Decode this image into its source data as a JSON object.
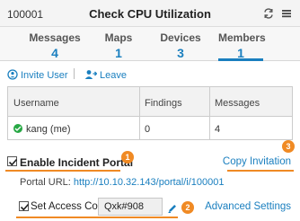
{
  "header": {
    "incident_id": "100001",
    "title": "Check CPU Utilization",
    "icons": [
      "refresh-icon",
      "menu-icon"
    ]
  },
  "tabs": [
    {
      "label": "Messages",
      "count": "4"
    },
    {
      "label": "Maps",
      "count": "1"
    },
    {
      "label": "Devices",
      "count": "3"
    },
    {
      "label": "Members",
      "count": "1",
      "active": true
    }
  ],
  "actions": {
    "invite_user": "Invite User",
    "leave": "Leave"
  },
  "members_table": {
    "columns": [
      "Username",
      "Findings",
      "Messages"
    ],
    "rows": [
      {
        "username": "kang (me)",
        "findings": "0",
        "messages": "4",
        "status": "online"
      }
    ]
  },
  "portal": {
    "enable_label": "Enable Incident Portal",
    "enabled": true,
    "copy_invitation": "Copy Invitation",
    "url_label": "Portal URL:",
    "url": "http://10.10.32.143/portal/i/100001",
    "set_access_code_label": "Set Access Code",
    "access_code_checked": true,
    "access_code_value": "Qxk#908",
    "advanced_settings": "Advanced Settings"
  },
  "callouts": [
    "1",
    "2",
    "3"
  ],
  "colors": {
    "accent": "#1a7fbf",
    "callout": "#f08a24",
    "online": "#27a844"
  }
}
